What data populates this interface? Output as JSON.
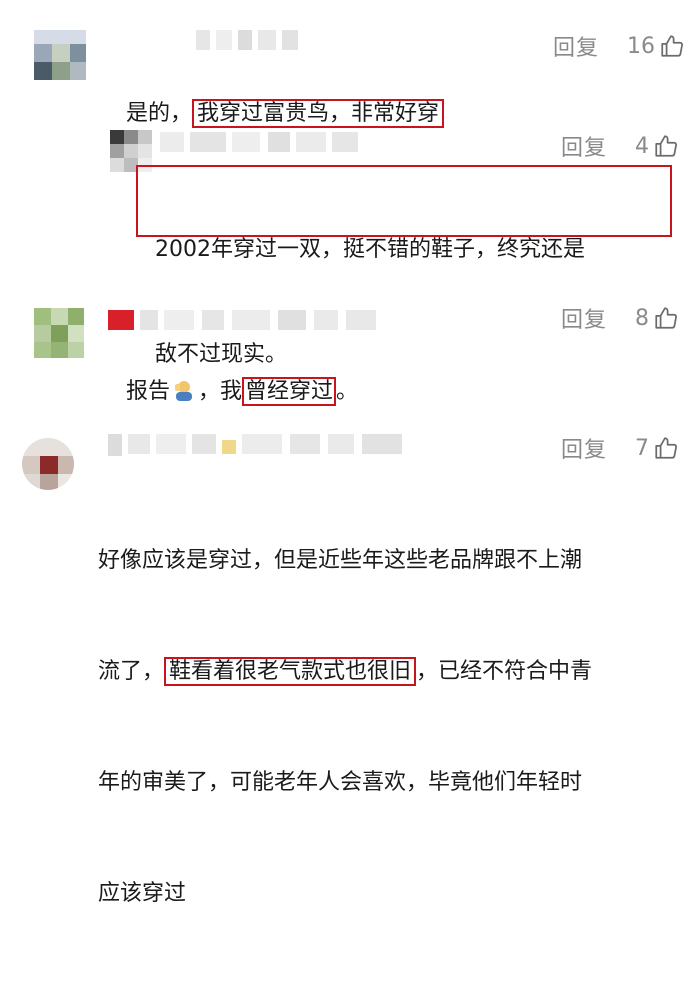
{
  "comments": [
    {
      "text_prefix": "是的，",
      "text_highlight": "我穿过富贵鸟，非常好穿",
      "reply_label": "回复",
      "likes": "16"
    },
    {
      "text_line1": "2002年穿过一双，挺不错的鞋子，终究还是",
      "text_line2": "敌不过现实。",
      "reply_label": "回复",
      "likes": "4"
    },
    {
      "text_prefix": "报告",
      "text_middle": "，我",
      "text_highlight": "曾经穿过",
      "text_suffix": "。",
      "reply_label": "回复",
      "likes": "8"
    },
    {
      "text_line1": "好像应该是穿过，但是近些年这些老品牌跟不上潮",
      "text_line2_prefix": "流了，",
      "text_line2_highlight": "鞋看着很老气款式也很旧",
      "text_line2_suffix": "，已经不符合中青",
      "text_line3": "年的审美了，可能老年人会喜欢，毕竟他们年轻时",
      "text_line4": "应该穿过",
      "reply_label": "回复",
      "likes": "7"
    }
  ],
  "icons": {
    "like": "thumbs-up-icon",
    "emoji": "person-emoji-icon"
  },
  "colors": {
    "highlight_border": "#c8141c",
    "muted_text": "#8a8a8a",
    "body_text": "#1a1a1a"
  }
}
